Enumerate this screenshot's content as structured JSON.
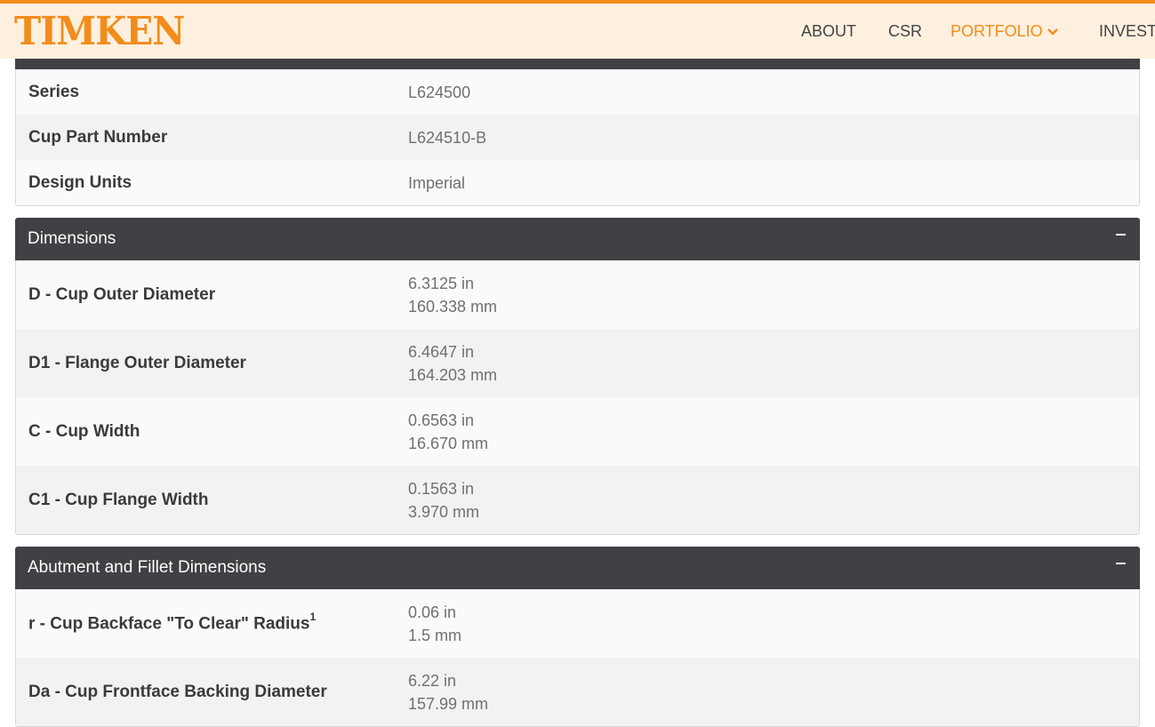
{
  "header": {
    "logo": "TIMKEN",
    "nav": [
      {
        "label": "ABOUT"
      },
      {
        "label": "CSR"
      },
      {
        "label": "PORTFOLIO"
      },
      {
        "label": "INVESTO"
      }
    ],
    "active_color": "#f28c1c"
  },
  "general": {
    "rows": [
      {
        "label": "Series",
        "value": "L624500"
      },
      {
        "label": "Cup Part Number",
        "value": "L624510-B"
      },
      {
        "label": "Design Units",
        "value": "Imperial"
      }
    ]
  },
  "dimensions": {
    "title": "Dimensions",
    "rows": [
      {
        "label": "D - Cup Outer Diameter",
        "in": "6.3125 in",
        "mm": "160.338 mm"
      },
      {
        "label": "D1 - Flange Outer Diameter",
        "in": "6.4647 in",
        "mm": "164.203 mm"
      },
      {
        "label": "C - Cup Width",
        "in": "0.6563 in",
        "mm": "16.670 mm"
      },
      {
        "label": "C1 - Cup Flange Width",
        "in": "0.1563 in",
        "mm": "3.970 mm"
      }
    ]
  },
  "abutment": {
    "title": "Abutment and Fillet Dimensions",
    "rows": [
      {
        "label": "r - Cup Backface \"To Clear\" Radius",
        "sup": "1",
        "in": "0.06 in",
        "mm": "1.5 mm"
      },
      {
        "label": "Da - Cup Frontface Backing Diameter",
        "in": "6.22 in",
        "mm": "157.99 mm"
      }
    ]
  }
}
